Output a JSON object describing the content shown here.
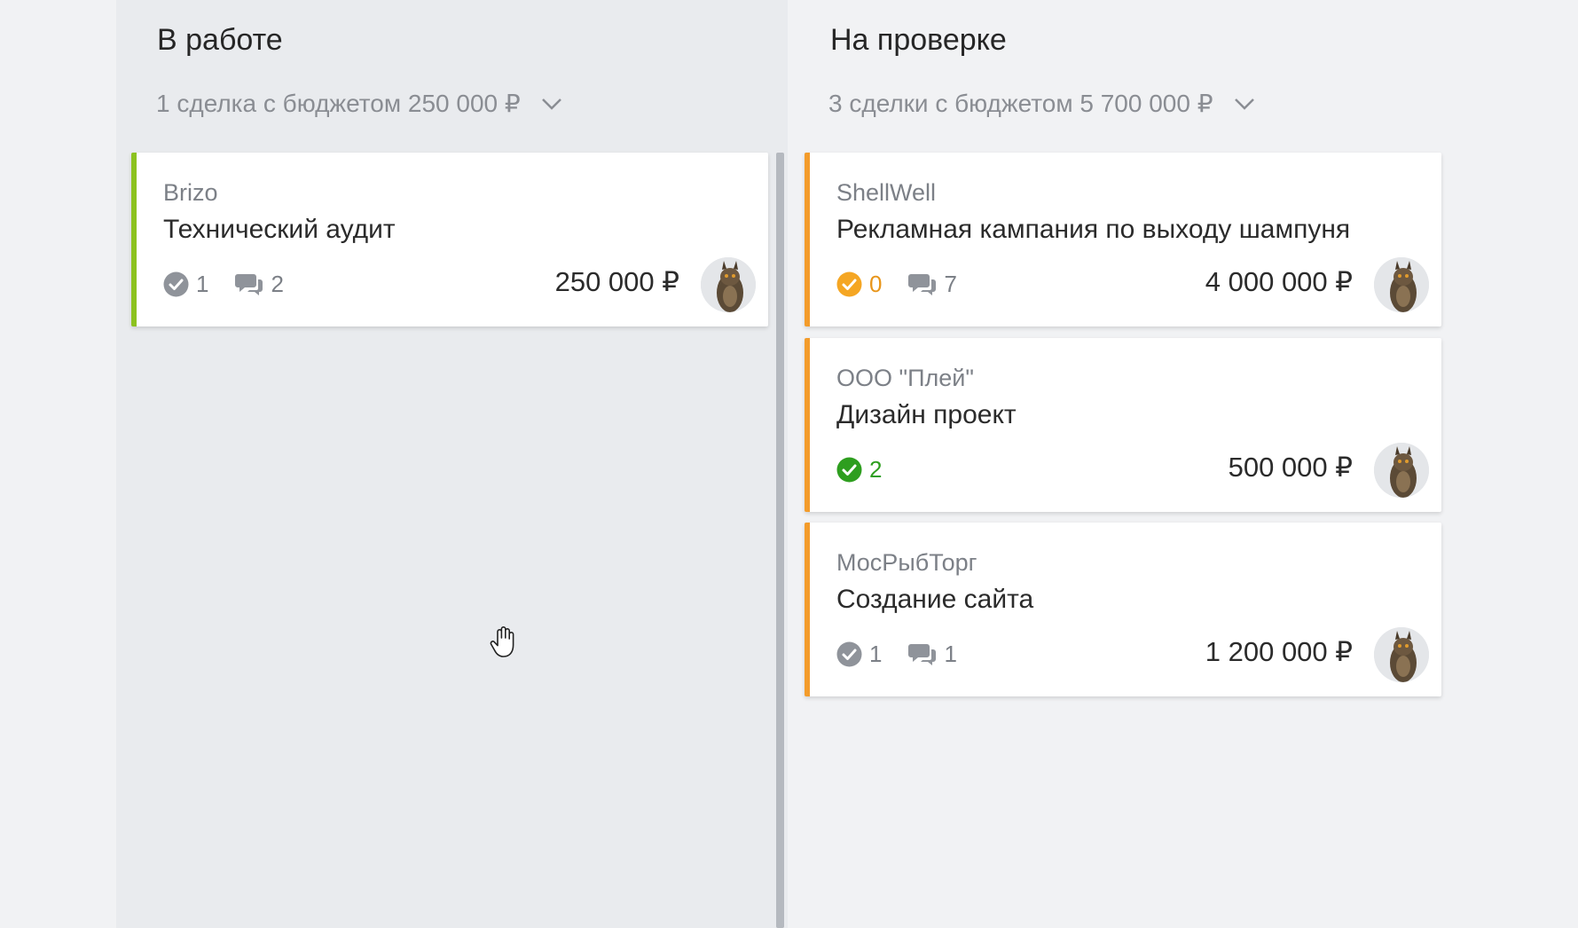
{
  "columns": [
    {
      "title": "В работе",
      "summary": "1 сделка с бюджетом 250 000 ₽",
      "cards": [
        {
          "company": "Brizo",
          "title": "Технический аудит",
          "tasks": "1",
          "comments": "2",
          "amount": "250 000 ₽",
          "task_status": "neutral",
          "stripe_color": "#8cc21f"
        }
      ]
    },
    {
      "title": "На проверке",
      "summary": "3 сделки с бюджетом 5 700 000 ₽",
      "cards": [
        {
          "company": "ShellWell",
          "title": "Рекламная кампания по выходу шампуня",
          "tasks": "0",
          "comments": "7",
          "amount": "4 000 000 ₽",
          "task_status": "overdue",
          "stripe_color": "#f39c2b"
        },
        {
          "company": "ООО \"Плей\"",
          "title": "Дизайн проект",
          "tasks": "2",
          "amount": "500 000 ₽",
          "task_status": "done",
          "stripe_color": "#f39c2b"
        },
        {
          "company": "МосРыбТорг",
          "title": "Создание сайта",
          "tasks": "1",
          "comments": "1",
          "amount": "1 200 000 ₽",
          "task_status": "neutral",
          "stripe_color": "#f39c2b"
        }
      ]
    }
  ],
  "colors": {
    "check_neutral": "#8f939a",
    "check_overdue": "#f5a623",
    "check_done": "#2e9e1f",
    "comment_icon": "#8f939a"
  }
}
